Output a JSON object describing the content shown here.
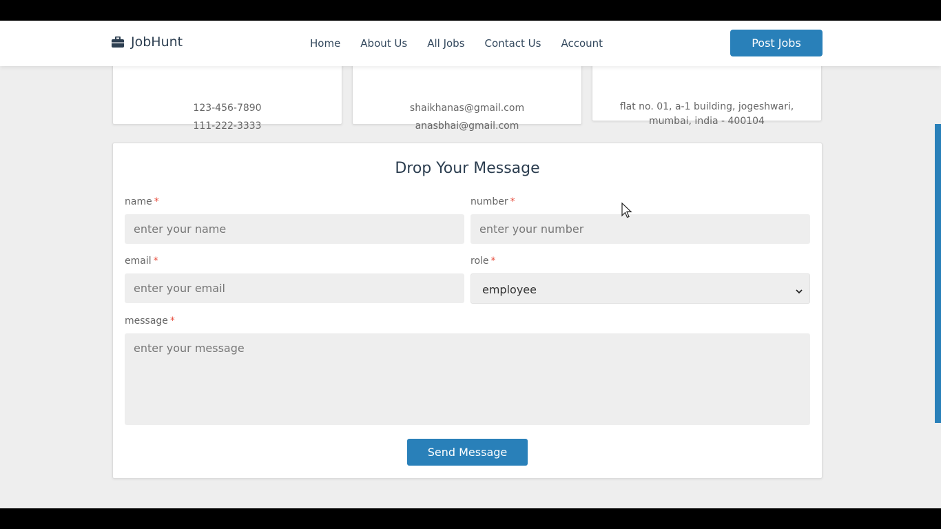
{
  "header": {
    "brand": "JobHunt",
    "nav": [
      "Home",
      "About Us",
      "All Jobs",
      "Contact Us",
      "Account"
    ],
    "post_button": "Post Jobs",
    "icons": {
      "logo": "briefcase-icon"
    }
  },
  "contact_cards": {
    "phones": [
      "123-456-7890",
      "111-222-3333"
    ],
    "emails": [
      "shaikhanas@gmail.com",
      "anasbhai@gmail.com"
    ],
    "address": "flat no. 01, a-1 building, jogeshwari, mumbai, india - 400104"
  },
  "form": {
    "title": "Drop Your Message",
    "required_mark": "*",
    "name_label": "name",
    "name_placeholder": "enter your name",
    "number_label": "number",
    "number_placeholder": "enter your number",
    "email_label": "email",
    "email_placeholder": "enter your email",
    "role_label": "role",
    "role_value": "employee",
    "message_label": "message",
    "message_placeholder": "enter your message",
    "send_button": "Send Message"
  },
  "colors": {
    "accent": "#2980b9",
    "required": "#e74c3c",
    "page_bg": "#eeeeee"
  }
}
